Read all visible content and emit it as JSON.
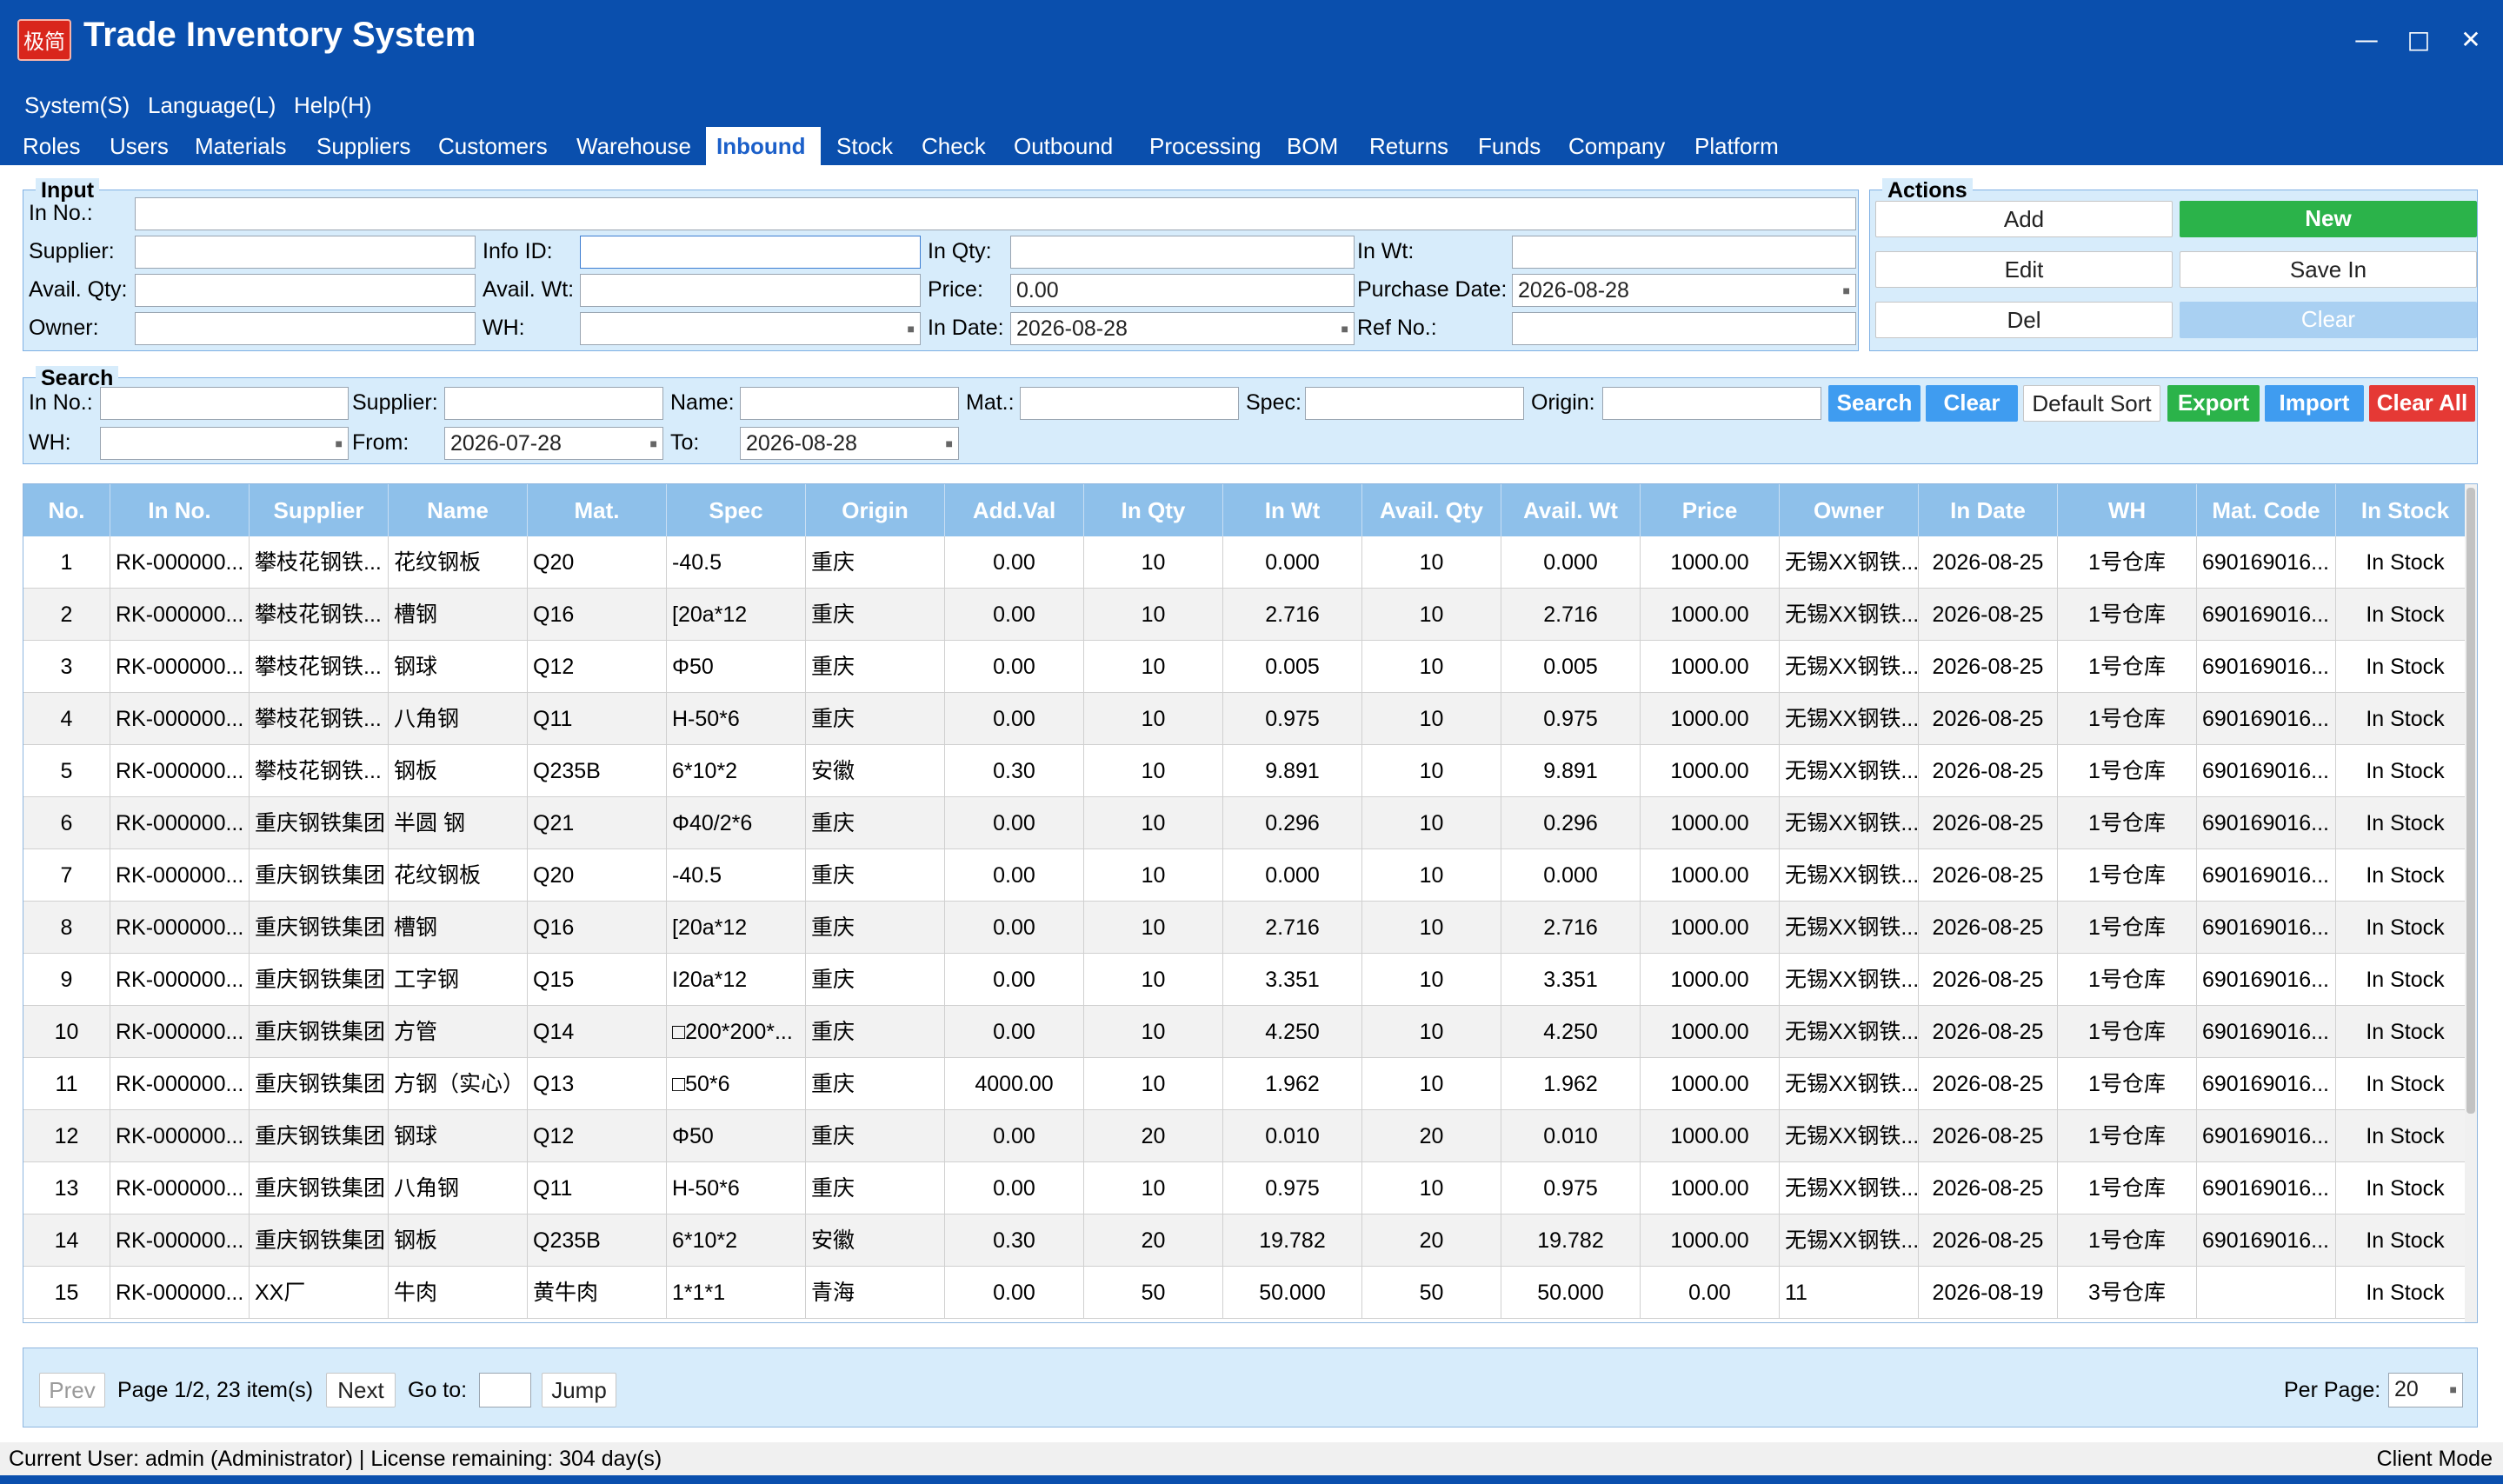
{
  "window": {
    "logo": "极简",
    "title": "Trade Inventory System"
  },
  "menu": [
    "System(S)",
    "Language(L)",
    "Help(H)"
  ],
  "tabs": [
    "Roles",
    "Users",
    "Materials",
    "Suppliers",
    "Customers",
    "Warehouse",
    "Inbound",
    "Stock",
    "Check",
    "Outbound",
    "Processing",
    "BOM",
    "Returns",
    "Funds",
    "Company",
    "Platform"
  ],
  "active_tab": "Inbound",
  "input": {
    "title": "Input",
    "in_no_label": "In No.:",
    "in_no_value": "",
    "supplier_label": "Supplier:",
    "supplier_value": "",
    "info_id_label": "Info ID:",
    "info_id_value": "",
    "in_qty_label": "In Qty:",
    "in_qty_value": "",
    "in_wt_label": "In Wt:",
    "in_wt_value": "",
    "avail_qty_label": "Avail. Qty:",
    "avail_qty_value": "",
    "avail_wt_label": "Avail. Wt:",
    "avail_wt_value": "",
    "price_label": "Price:",
    "price_value": "0.00",
    "purchase_date_label": "Purchase Date:",
    "purchase_date_value": "2026-08-28",
    "owner_label": "Owner:",
    "owner_value": "",
    "wh_label": "WH:",
    "wh_value": "",
    "in_date_label": "In Date:",
    "in_date_value": "2026-08-28",
    "ref_no_label": "Ref No.:",
    "ref_no_value": ""
  },
  "actions": {
    "title": "Actions",
    "add": "Add",
    "new": "New",
    "edit": "Edit",
    "save_in": "Save In",
    "del": "Del",
    "clear": "Clear"
  },
  "search": {
    "title": "Search",
    "in_no_label": "In No.:",
    "supplier_label": "Supplier:",
    "name_label": "Name:",
    "mat_label": "Mat.:",
    "spec_label": "Spec:",
    "origin_label": "Origin:",
    "wh_label": "WH:",
    "from_label": "From:",
    "to_label": "To:",
    "from_value": "2026-07-28",
    "to_value": "2026-08-28",
    "search_btn": "Search",
    "clear_btn": "Clear",
    "default_sort_btn": "Default Sort",
    "export_btn": "Export",
    "import_btn": "Import",
    "clear_all_btn": "Clear All"
  },
  "table": {
    "columns": [
      "No.",
      "In No.",
      "Supplier",
      "Name",
      "Mat.",
      "Spec",
      "Origin",
      "Add.Val",
      "In Qty",
      "In Wt",
      "Avail. Qty",
      "Avail. Wt",
      "Price",
      "Owner",
      "In Date",
      "WH",
      "Mat. Code",
      "In Stock"
    ],
    "rows": [
      [
        "1",
        "RK-000000...",
        "攀枝花钢铁...",
        "花纹钢板",
        "Q20",
        "-40.5",
        "重庆",
        "0.00",
        "10",
        "0.000",
        "10",
        "0.000",
        "1000.00",
        "无锡XX钢铁...",
        "2026-08-25",
        "1号仓库",
        "690169016...",
        "In Stock"
      ],
      [
        "2",
        "RK-000000...",
        "攀枝花钢铁...",
        "槽钢",
        "Q16",
        "[20a*12",
        "重庆",
        "0.00",
        "10",
        "2.716",
        "10",
        "2.716",
        "1000.00",
        "无锡XX钢铁...",
        "2026-08-25",
        "1号仓库",
        "690169016...",
        "In Stock"
      ],
      [
        "3",
        "RK-000000...",
        "攀枝花钢铁...",
        "钢球",
        "Q12",
        "Φ50",
        "重庆",
        "0.00",
        "10",
        "0.005",
        "10",
        "0.005",
        "1000.00",
        "无锡XX钢铁...",
        "2026-08-25",
        "1号仓库",
        "690169016...",
        "In Stock"
      ],
      [
        "4",
        "RK-000000...",
        "攀枝花钢铁...",
        "八角钢",
        "Q11",
        "H-50*6",
        "重庆",
        "0.00",
        "10",
        "0.975",
        "10",
        "0.975",
        "1000.00",
        "无锡XX钢铁...",
        "2026-08-25",
        "1号仓库",
        "690169016...",
        "In Stock"
      ],
      [
        "5",
        "RK-000000...",
        "攀枝花钢铁...",
        "钢板",
        "Q235B",
        "6*10*2",
        "安徽",
        "0.30",
        "10",
        "9.891",
        "10",
        "9.891",
        "1000.00",
        "无锡XX钢铁...",
        "2026-08-25",
        "1号仓库",
        "690169016...",
        "In Stock"
      ],
      [
        "6",
        "RK-000000...",
        "重庆钢铁集团",
        "半圆 钢",
        "Q21",
        "Φ40/2*6",
        "重庆",
        "0.00",
        "10",
        "0.296",
        "10",
        "0.296",
        "1000.00",
        "无锡XX钢铁...",
        "2026-08-25",
        "1号仓库",
        "690169016...",
        "In Stock"
      ],
      [
        "7",
        "RK-000000...",
        "重庆钢铁集团",
        "花纹钢板",
        "Q20",
        "-40.5",
        "重庆",
        "0.00",
        "10",
        "0.000",
        "10",
        "0.000",
        "1000.00",
        "无锡XX钢铁...",
        "2026-08-25",
        "1号仓库",
        "690169016...",
        "In Stock"
      ],
      [
        "8",
        "RK-000000...",
        "重庆钢铁集团",
        "槽钢",
        "Q16",
        "[20a*12",
        "重庆",
        "0.00",
        "10",
        "2.716",
        "10",
        "2.716",
        "1000.00",
        "无锡XX钢铁...",
        "2026-08-25",
        "1号仓库",
        "690169016...",
        "In Stock"
      ],
      [
        "9",
        "RK-000000...",
        "重庆钢铁集团",
        "工字钢",
        "Q15",
        "I20a*12",
        "重庆",
        "0.00",
        "10",
        "3.351",
        "10",
        "3.351",
        "1000.00",
        "无锡XX钢铁...",
        "2026-08-25",
        "1号仓库",
        "690169016...",
        "In Stock"
      ],
      [
        "10",
        "RK-000000...",
        "重庆钢铁集团",
        "方管",
        "Q14",
        "□200*200*...",
        "重庆",
        "0.00",
        "10",
        "4.250",
        "10",
        "4.250",
        "1000.00",
        "无锡XX钢铁...",
        "2026-08-25",
        "1号仓库",
        "690169016...",
        "In Stock"
      ],
      [
        "11",
        "RK-000000...",
        "重庆钢铁集团",
        "方钢（实心）",
        "Q13",
        "□50*6",
        "重庆",
        "4000.00",
        "10",
        "1.962",
        "10",
        "1.962",
        "1000.00",
        "无锡XX钢铁...",
        "2026-08-25",
        "1号仓库",
        "690169016...",
        "In Stock"
      ],
      [
        "12",
        "RK-000000...",
        "重庆钢铁集团",
        "钢球",
        "Q12",
        "Φ50",
        "重庆",
        "0.00",
        "20",
        "0.010",
        "20",
        "0.010",
        "1000.00",
        "无锡XX钢铁...",
        "2026-08-25",
        "1号仓库",
        "690169016...",
        "In Stock"
      ],
      [
        "13",
        "RK-000000...",
        "重庆钢铁集团",
        "八角钢",
        "Q11",
        "H-50*6",
        "重庆",
        "0.00",
        "10",
        "0.975",
        "10",
        "0.975",
        "1000.00",
        "无锡XX钢铁...",
        "2026-08-25",
        "1号仓库",
        "690169016...",
        "In Stock"
      ],
      [
        "14",
        "RK-000000...",
        "重庆钢铁集团",
        "钢板",
        "Q235B",
        "6*10*2",
        "安徽",
        "0.30",
        "20",
        "19.782",
        "20",
        "19.782",
        "1000.00",
        "无锡XX钢铁...",
        "2026-08-25",
        "1号仓库",
        "690169016...",
        "In Stock"
      ],
      [
        "15",
        "RK-000000...",
        "XX厂",
        "牛肉",
        "黄牛肉",
        "1*1*1",
        "青海",
        "0.00",
        "50",
        "50.000",
        "50",
        "50.000",
        "0.00",
        "11",
        "2026-08-19",
        "3号仓库",
        "",
        "In Stock"
      ]
    ]
  },
  "pager": {
    "prev": "Prev",
    "page_info": "Page 1/2, 23 item(s)",
    "next": "Next",
    "goto_label": "Go to:",
    "goto_value": "",
    "jump": "Jump",
    "per_page_label": "Per Page:",
    "per_page_value": "20"
  },
  "status": {
    "user": "Current User: admin (Administrator)   |  License remaining: 304 day(s)",
    "mode": "Client Mode"
  }
}
